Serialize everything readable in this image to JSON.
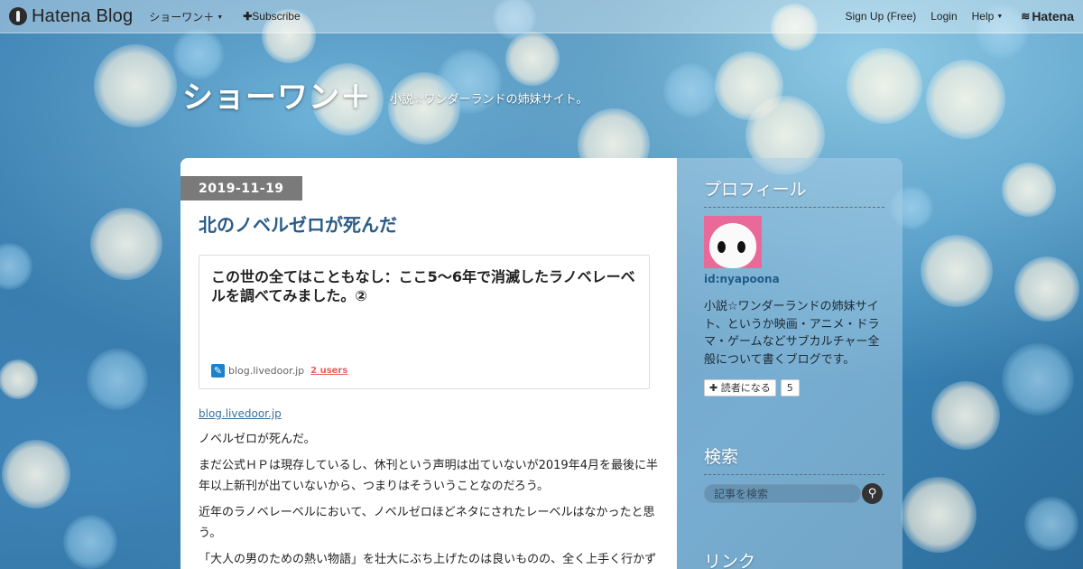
{
  "topbar": {
    "brand": "Hatena Blog",
    "blog_menu": "ショーワン＋",
    "subscribe": "Subscribe",
    "signup": "Sign Up (Free)",
    "login": "Login",
    "help": "Help",
    "hatena": "Hatena"
  },
  "header": {
    "title": "ショーワン＋",
    "description": "小説☆ワンダーランドの姉妹サイト。"
  },
  "entry": {
    "date": "2019-11-19",
    "title": "北のノベルゼロが死んだ",
    "embed": {
      "title": "この世の全てはこともなし：ここ5〜6年で消滅したラノベレーベルを調べてみました。②",
      "domain": "blog.livedoor.jp",
      "users": "2 users"
    },
    "source_link": "blog.livedoor.jp",
    "paragraphs": [
      "ノベルゼロが死んだ。",
      "まだ公式ＨＰは現存しているし、休刊という声明は出ていないが2019年4月を最後に半年以上新刊が出ていないから、つまりはそういうことなのだろう。",
      "近年のラノベレーベルにおいて、ノベルゼロほどネタにされたレーベルはなかったと思う。",
      "「大人の男のための熱い物語」を壮大にぶち上げたのは良いものの、全く上手く行かず"
    ]
  },
  "sidebar": {
    "profile_heading": "プロフィール",
    "profile_id": "id:nyapoona",
    "profile_desc": "小説☆ワンダーランドの姉妹サイト、というか映画・アニメ・ドラマ・ゲームなどサブカルチャー全般について書くブログです。",
    "reader_button": "読者になる",
    "reader_count": "5",
    "search_heading": "検索",
    "search_placeholder": "記事を検索",
    "links_heading": "リンク"
  },
  "colors": {
    "title_link": "#2b5b86",
    "users_badge": "#e8605d",
    "date_badge": "#7a7a7a"
  }
}
